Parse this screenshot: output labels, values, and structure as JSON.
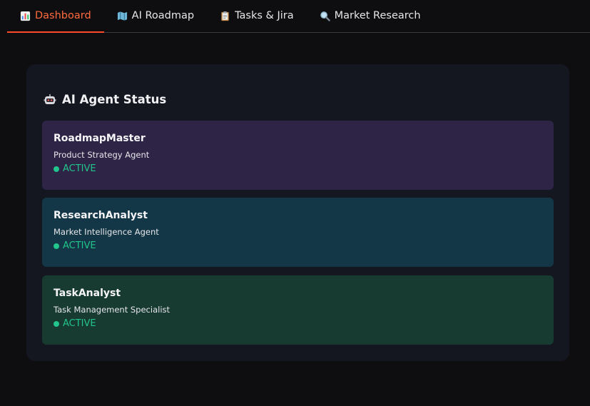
{
  "tabs": [
    {
      "label": "Dashboard",
      "icon": "bar-chart-icon",
      "active": true
    },
    {
      "label": "AI Roadmap",
      "icon": "map-icon",
      "active": false
    },
    {
      "label": "Tasks & Jira",
      "icon": "clipboard-icon",
      "active": false
    },
    {
      "label": "Market Research",
      "icon": "magnifier-icon",
      "active": false
    }
  ],
  "panel": {
    "title": "AI Agent Status",
    "title_icon": "robot-icon"
  },
  "agents": [
    {
      "name": "RoadmapMaster",
      "role": "Product Strategy Agent",
      "status": "ACTIVE",
      "color": "#2e2446"
    },
    {
      "name": "ResearchAnalyst",
      "role": "Market Intelligence Agent",
      "status": "ACTIVE",
      "color": "#133747"
    },
    {
      "name": "TaskAnalyst",
      "role": "Task Management Specialist",
      "status": "ACTIVE",
      "color": "#173b31"
    }
  ],
  "colors": {
    "accent": "#ff4b2b",
    "status_active": "#22c58b",
    "background": "#0e0e10",
    "panel": "#141620"
  }
}
